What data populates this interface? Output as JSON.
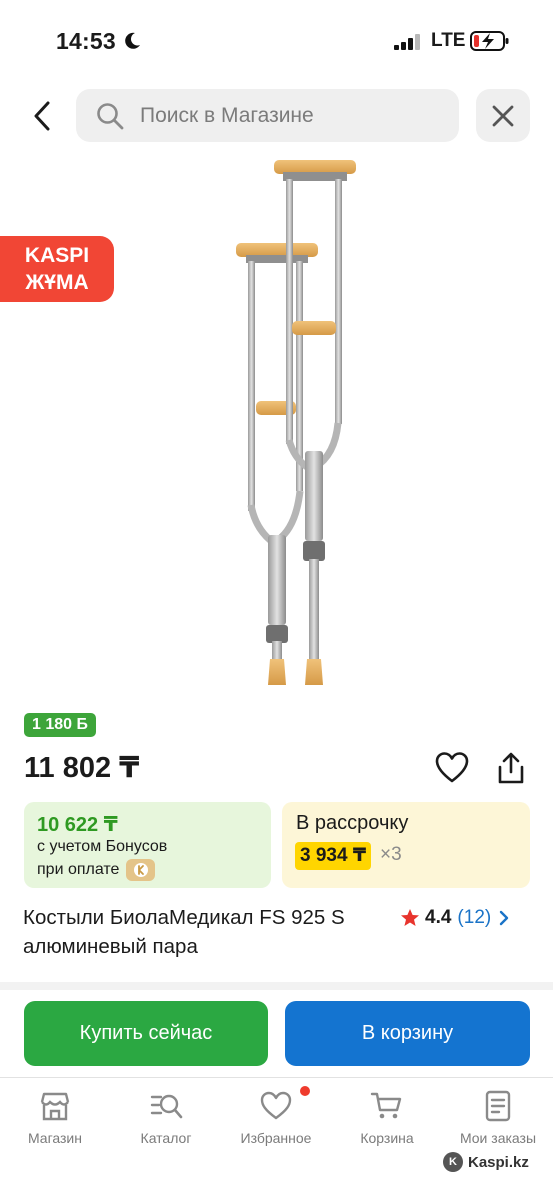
{
  "status_bar": {
    "time": "14:53",
    "network": "LTE"
  },
  "search": {
    "placeholder": "Поиск в Магазине"
  },
  "promo_badge": {
    "line1": "KASPI",
    "line2": "ЖҰМА",
    "color": "#f14635"
  },
  "product": {
    "bonus_amount": "1 180 Ƃ",
    "price": "11 802 ₸",
    "bonus_price": "10 622 ₸",
    "bonus_caption_line1": "с учетом Бонусов",
    "bonus_caption_line2": "при оплате",
    "installment_label": "В рассрочку",
    "installment_price": "3 934 ₸",
    "installment_multiplier": "×3",
    "title": "Костыли БиолаМедикал FS 925 S алюминевый пара",
    "rating": "4.4",
    "reviews": "(12)"
  },
  "actions": {
    "buy_now": "Купить сейчас",
    "add_to_cart": "В корзину"
  },
  "tabs": [
    {
      "label": "Магазин",
      "icon": "store-icon"
    },
    {
      "label": "Каталог",
      "icon": "catalog-icon"
    },
    {
      "label": "Избранное",
      "icon": "heart-icon"
    },
    {
      "label": "Корзина",
      "icon": "cart-icon"
    },
    {
      "label": "Мои заказы",
      "icon": "orders-icon"
    }
  ],
  "watermark": "Kaspi.kz",
  "colors": {
    "green": "#2ba842",
    "blue": "#1474d0",
    "accent_red": "#f14635",
    "installment_yellow": "#ffd500"
  }
}
